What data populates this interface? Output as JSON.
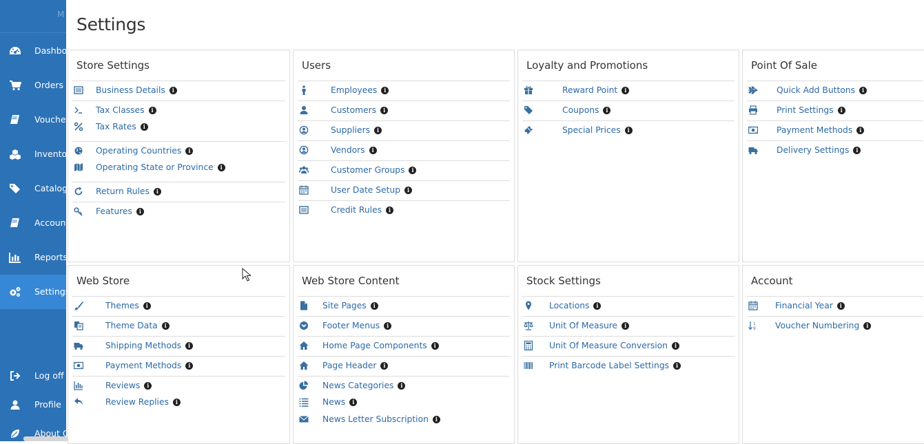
{
  "sidebar": {
    "brand": "M",
    "items": [
      {
        "label": "Dashboard",
        "icon": "dashboard-icon"
      },
      {
        "label": "Orders",
        "icon": "cart-icon"
      },
      {
        "label": "Vouchers",
        "icon": "book-icon"
      },
      {
        "label": "Inventory",
        "icon": "cubes-icon"
      },
      {
        "label": "Catalog",
        "icon": "tags-icon"
      },
      {
        "label": "Accounts",
        "icon": "book-icon"
      },
      {
        "label": "Reports",
        "icon": "bar-chart-icon"
      },
      {
        "label": "Settings",
        "icon": "cogs-icon",
        "active": true
      }
    ],
    "bottom": [
      {
        "label": "Log off",
        "icon": "sign-out-icon"
      },
      {
        "label": "Profile",
        "icon": "user-icon"
      },
      {
        "label": "About O",
        "icon": "leaf-icon"
      }
    ]
  },
  "page": {
    "title": "Settings"
  },
  "panels": [
    {
      "title": "Store Settings",
      "rows": [
        {
          "label": "Business Details",
          "icon": "list-alt-icon"
        },
        {
          "label": "Tax Classes",
          "icon": "tax-icon"
        },
        {
          "label": "Tax Rates",
          "icon": "percent-icon"
        },
        {
          "label": "Operating Countries",
          "icon": "globe-icon"
        },
        {
          "label": "Operating State or Province",
          "icon": "map-icon"
        },
        {
          "label": "Return Rules",
          "icon": "refresh-icon"
        },
        {
          "label": "Features",
          "icon": "key-icon"
        }
      ]
    },
    {
      "title": "Users",
      "rows": [
        {
          "label": "Employees",
          "icon": "male-icon"
        },
        {
          "label": "Customers",
          "icon": "user-icon"
        },
        {
          "label": "Suppliers",
          "icon": "user-circle-icon"
        },
        {
          "label": "Vendors",
          "icon": "user-circle-icon"
        },
        {
          "label": "Customer Groups",
          "icon": "users-icon"
        },
        {
          "label": "User Date Setup",
          "icon": "calendar-icon"
        },
        {
          "label": "Credit Rules",
          "icon": "list-alt-icon"
        }
      ]
    },
    {
      "title": "Loyalty and Promotions",
      "rows": [
        {
          "label": "Reward Point",
          "icon": "gift-icon"
        },
        {
          "label": "Coupons",
          "icon": "tags-icon"
        },
        {
          "label": "Special Prices",
          "icon": "ticket-icon"
        }
      ]
    },
    {
      "title": "Point Of Sale",
      "rows": [
        {
          "label": "Quick Add Buttons",
          "icon": "plane-icon"
        },
        {
          "label": "Print Settings",
          "icon": "print-icon"
        },
        {
          "label": "Payment Methods",
          "icon": "money-icon"
        },
        {
          "label": "Delivery Settings",
          "icon": "truck-icon"
        }
      ]
    },
    {
      "title": "Web Store",
      "rows": [
        {
          "label": "Themes",
          "icon": "paint-brush-icon"
        },
        {
          "label": "Theme Data",
          "icon": "copy-icon"
        },
        {
          "label": "Shipping Methods",
          "icon": "truck-icon"
        },
        {
          "label": "Payment Methods",
          "icon": "money-icon"
        },
        {
          "label": "Reviews",
          "icon": "bar-chart-icon"
        },
        {
          "label": "Review Replies",
          "icon": "reply-icon"
        }
      ]
    },
    {
      "title": "Web Store Content",
      "rows": [
        {
          "label": "Site Pages",
          "icon": "file-icon"
        },
        {
          "label": "Footer Menus",
          "icon": "chevron-circle-down-icon"
        },
        {
          "label": "Home Page Components",
          "icon": "home-icon"
        },
        {
          "label": "Page Header",
          "icon": "home-icon"
        },
        {
          "label": "News Categories",
          "icon": "pie-chart-icon"
        },
        {
          "label": "News",
          "icon": "list-icon"
        },
        {
          "label": "News Letter Subscription",
          "icon": "envelope-icon"
        }
      ]
    },
    {
      "title": "Stock Settings",
      "rows": [
        {
          "label": "Locations",
          "icon": "map-marker-icon"
        },
        {
          "label": "Unit Of Measure",
          "icon": "balance-scale-icon"
        },
        {
          "label": "Unit Of Measure Conversion",
          "icon": "calculator-icon"
        },
        {
          "label": "Print Barcode Label Settings",
          "icon": "barcode-icon"
        }
      ]
    },
    {
      "title": "Account",
      "rows": [
        {
          "label": "Financial Year",
          "icon": "calendar-icon"
        },
        {
          "label": "Voucher Numbering",
          "icon": "sort-numeric-icon"
        }
      ]
    }
  ],
  "info_glyph": "i",
  "colors": {
    "sidebar": "#2c72b7",
    "sidebar_active": "#3687d6",
    "link": "#2c6aa8",
    "icon": "#3a6f9e"
  }
}
